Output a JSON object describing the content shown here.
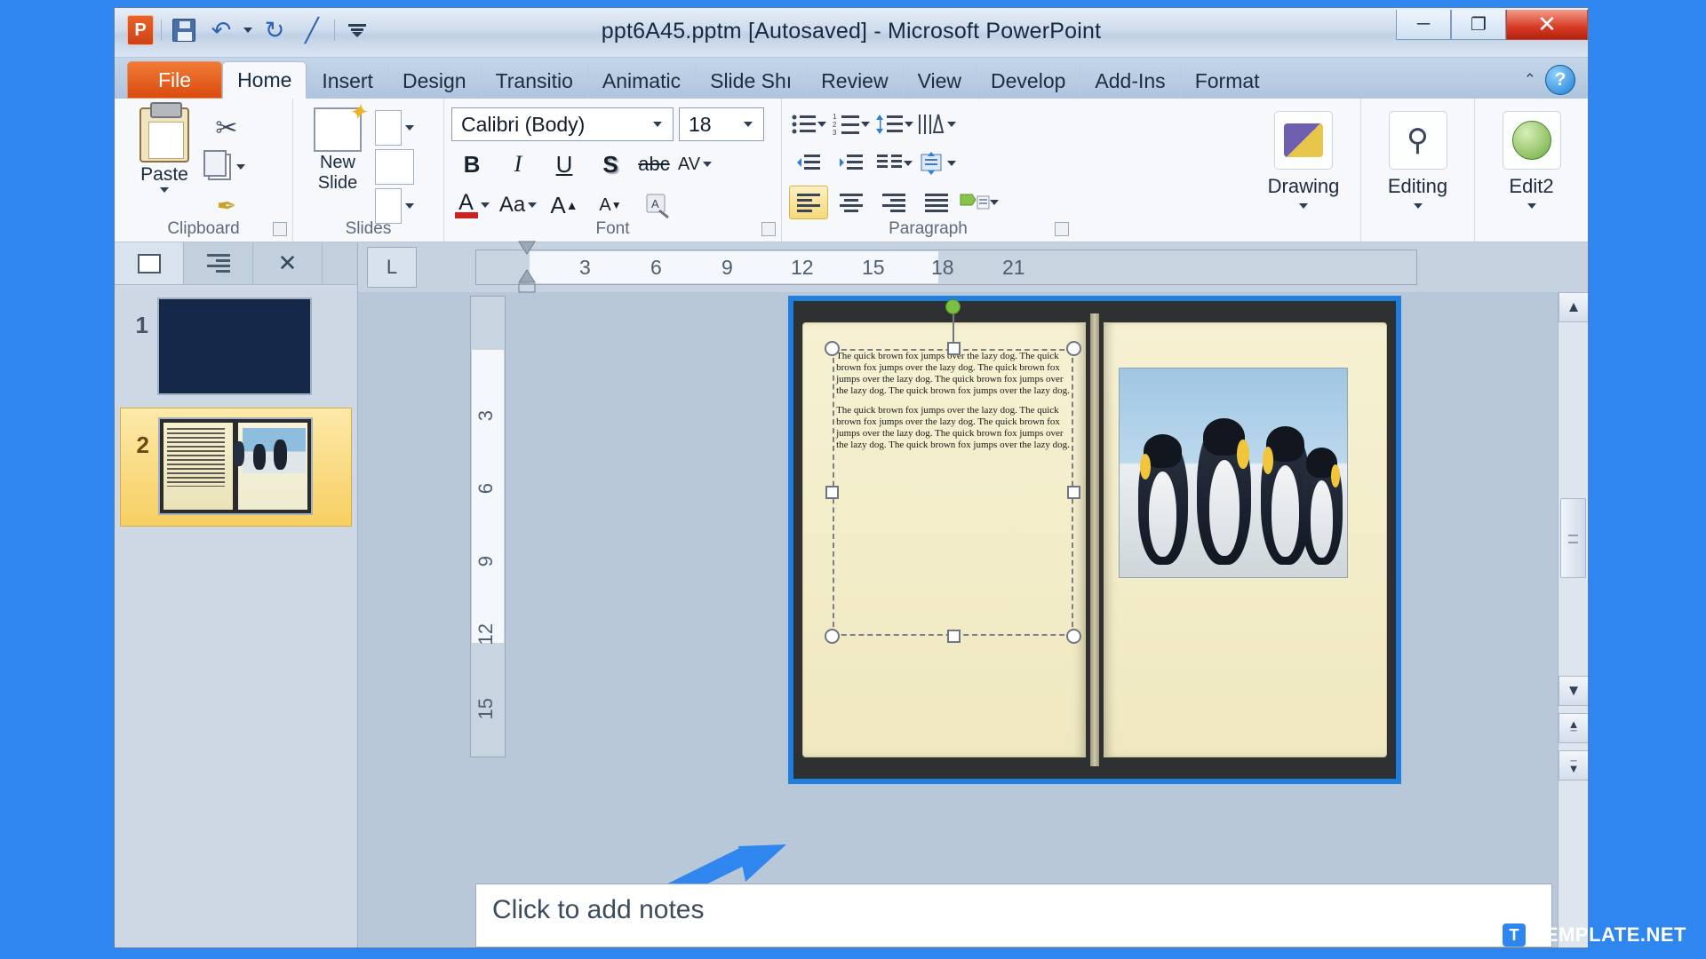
{
  "window": {
    "title": "ppt6A45.pptm [Autosaved]  -  Microsoft PowerPoint",
    "minimize": "─",
    "maximize": "❐",
    "close": "✕"
  },
  "quick_access": {
    "app_logo": "P",
    "save": "save-icon",
    "undo": "↶",
    "redo": "↻",
    "pen": "╱",
    "customize": "☰"
  },
  "tabs": [
    {
      "label": "File",
      "state": "file"
    },
    {
      "label": "Home",
      "state": "active"
    },
    {
      "label": "Insert",
      "state": "normal"
    },
    {
      "label": "Design",
      "state": "normal"
    },
    {
      "label": "Transitio",
      "state": "normal"
    },
    {
      "label": "Animatic",
      "state": "normal"
    },
    {
      "label": "Slide Shı",
      "state": "normal"
    },
    {
      "label": "Review",
      "state": "normal"
    },
    {
      "label": "View",
      "state": "normal"
    },
    {
      "label": "Develop",
      "state": "normal"
    },
    {
      "label": "Add-Ins",
      "state": "normal"
    },
    {
      "label": "Format",
      "state": "normal"
    }
  ],
  "tab_right": {
    "collapse": "⌃",
    "help": "?"
  },
  "ribbon": {
    "groups": [
      {
        "label": "Clipboard"
      },
      {
        "label": "Slides"
      },
      {
        "label": "Font"
      },
      {
        "label": "Paragraph"
      }
    ],
    "clipboard": {
      "paste_label": "Paste",
      "cut": "✂",
      "copy": "copy-icon",
      "format_painter": "✒"
    },
    "slides": {
      "new_slide_line1": "New",
      "new_slide_line2": "Slide"
    },
    "font": {
      "font_name": "Calibri (Body)",
      "font_size": "18",
      "bold": "B",
      "italic": "I",
      "underline": "U",
      "shadow": "S",
      "strikethrough": "abc",
      "char_spacing": "AV",
      "font_color": "A",
      "change_case": "Aa",
      "grow_font": "A",
      "shrink_font": "A",
      "clear_formatting": "clear-formatting-icon"
    },
    "paragraph": {
      "bullets": "bullets-icon",
      "numbering": "numbering-icon",
      "decrease_indent": "decrease-indent-icon",
      "increase_indent": "increase-indent-icon",
      "line_spacing": "line-spacing-icon",
      "text_direction": "text-direction-icon",
      "columns": "columns-icon",
      "align_text": "align-text-icon",
      "convert_smartart": "smartart-icon",
      "align_left": "align-left-icon",
      "align_center": "align-center-icon",
      "align_right": "align-right-icon",
      "justify": "justify-icon"
    },
    "right_buttons": [
      {
        "label": "Drawing",
        "icon": "shapes-icon"
      },
      {
        "label": "Editing",
        "icon": "binoculars-icon"
      },
      {
        "label": "Edit2",
        "icon": "globe-icon"
      }
    ]
  },
  "slide_pane": {
    "tab_slides": "slides-thumbnail-icon",
    "tab_outline": "outline-icon",
    "close": "✕",
    "slides": [
      {
        "number": "1",
        "selected": false,
        "kind": "blank-dark"
      },
      {
        "number": "2",
        "selected": true,
        "kind": "book-with-picture"
      }
    ]
  },
  "rulers": {
    "corner_marker": "L",
    "horizontal_ticks": [
      "3",
      "6",
      "9",
      "12",
      "15",
      "18",
      "21"
    ],
    "vertical_ticks": [
      "3",
      "6",
      "9",
      "12",
      "15"
    ]
  },
  "slide": {
    "text_block_1": "The quick brown fox jumps over the lazy dog. The quick brown fox jumps over the lazy dog. The quick brown fox jumps over the lazy dog. The quick brown fox jumps over the lazy dog. The quick brown fox jumps over the lazy dog.",
    "text_block_2": "The quick brown fox jumps over the lazy dog. The quick brown fox jumps over the lazy dog. The quick brown fox jumps over the lazy dog. The quick brown fox jumps over the lazy dog. The quick brown fox jumps over the lazy dog.",
    "picture_alt": "penguins-photo",
    "selection": "text-box-selected",
    "rotation_handle": "rotation-handle"
  },
  "scrollbar": {
    "up": "▲",
    "down": "▼",
    "prev_slide": "▲",
    "next_slide": "▼"
  },
  "notes": {
    "placeholder": "Click to add notes"
  },
  "watermark": {
    "mark": "T",
    "text": "TEMPLATE.NET"
  },
  "colors": {
    "accent_blue": "#2f86ef",
    "file_tab_orange": "#da4b10",
    "selection_yellow": "#f7cf62",
    "slide_border": "#1f7fe0"
  }
}
